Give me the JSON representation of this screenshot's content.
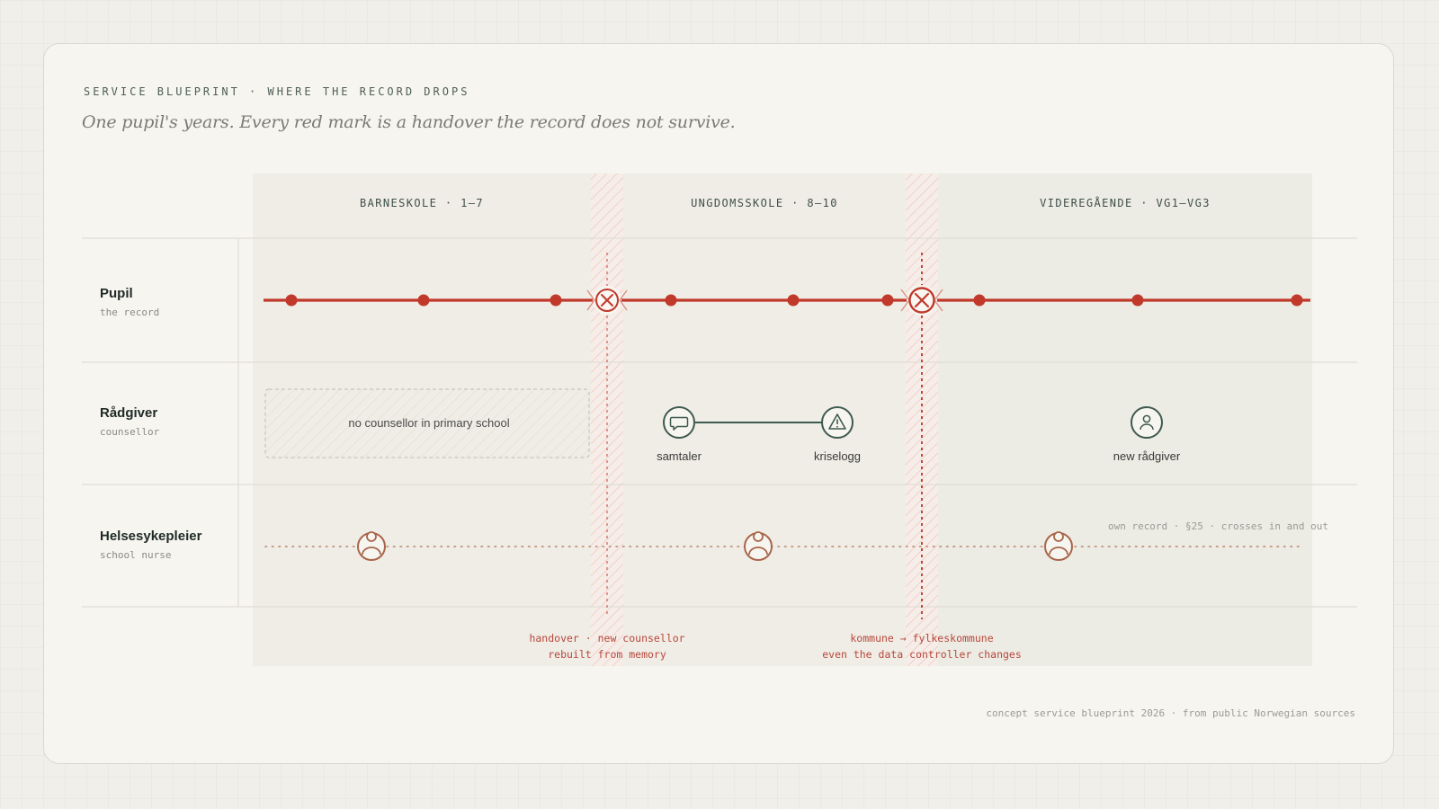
{
  "header": {
    "eyebrow": "SERVICE BLUEPRINT · WHERE THE RECORD DROPS",
    "subtitle": "One pupil's years. Every red mark is a handover the record does not survive."
  },
  "stages": [
    {
      "label": "BARNESKOLE · 1–7"
    },
    {
      "label": "UNGDOMSSKOLE · 8–10"
    },
    {
      "label": "VIDEREGÅENDE · VG1–VG3"
    }
  ],
  "lanes": [
    {
      "title": "Pupil",
      "subtitle": "the record"
    },
    {
      "title": "Rådgiver",
      "subtitle": "counsellor"
    },
    {
      "title": "Helsesykepleier",
      "subtitle": "school nurse"
    }
  ],
  "counsellor": {
    "empty_box": "no counsellor in primary school",
    "nodes": [
      {
        "label": "samtaler",
        "icon": "speech-bubble-icon"
      },
      {
        "label": "kriselogg",
        "icon": "warning-triangle-icon"
      },
      {
        "label": "new rådgiver",
        "icon": "person-icon"
      }
    ]
  },
  "nurse": {
    "annotation": "own record · §25 · crosses in and out",
    "icon": "nurse-icon"
  },
  "handovers": [
    {
      "line1": "handover · new counsellor",
      "line2": "rebuilt from memory",
      "icon": "break-x-icon"
    },
    {
      "line1": "kommune → fylkeskommune",
      "line2": "even the data controller changes",
      "icon": "break-x-icon"
    }
  ],
  "footer": "concept service blueprint 2026 · from public Norwegian sources",
  "colors": {
    "record_red": "#c0392b",
    "counsellor_green": "#3f5a4f",
    "nurse_brown": "#a8664a",
    "background": "#f7f5f0"
  }
}
